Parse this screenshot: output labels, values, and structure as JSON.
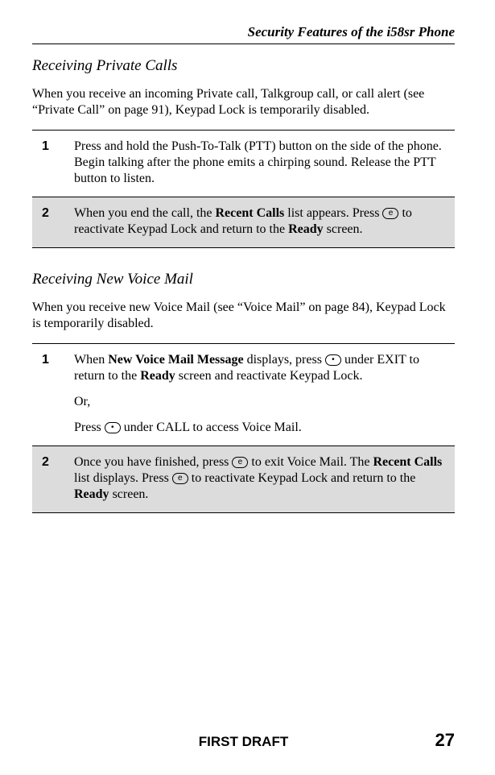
{
  "header": {
    "title": "Security Features of the i58sr Phone"
  },
  "section1": {
    "heading": "Receiving Private Calls",
    "intro": "When you receive an incoming Private call, Talkgroup call, or call alert (see “Private Call” on page 91), Keypad Lock is temporarily disabled.",
    "steps": [
      {
        "num": "1",
        "text": "Press and hold the Push-To-Talk (PTT) button on the side of the phone. Begin talking after the phone emits a chirping sound. Release the PTT button to listen."
      },
      {
        "num": "2",
        "p1a": "When you end the call, the ",
        "p1b": "Recent Calls",
        "p1c": " list appears. Press ",
        "icon": "e",
        "p1d": " to reactivate Keypad Lock and return to the ",
        "p1e": "Ready",
        "p1f": " screen."
      }
    ]
  },
  "section2": {
    "heading": "Receiving New Voice Mail",
    "intro": "When you receive new Voice Mail (see “Voice Mail” on page 84), Keypad Lock is temporarily disabled.",
    "steps": [
      {
        "num": "1",
        "p1a": "When ",
        "p1b": "New Voice Mail Message",
        "p1c": " displays, press ",
        "icon1": "•",
        "p1d": " under EXIT to return to the ",
        "p1e": "Ready",
        "p1f": " screen and reactivate Keypad Lock.",
        "p2": "Or,",
        "p3a": "Press ",
        "icon2": "•",
        "p3b": " under CALL to access Voice Mail."
      },
      {
        "num": "2",
        "p1a": "Once you have finished, press ",
        "icon1": "e",
        "p1b": " to exit Voice Mail. The ",
        "p1c": "Recent Calls",
        "p1d": " list displays. Press ",
        "icon2": "e",
        "p1e": " to reactivate Keypad Lock and return to the ",
        "p1f": "Ready",
        "p1g": " screen."
      }
    ]
  },
  "footer": {
    "center": "FIRST DRAFT",
    "page": "27"
  }
}
